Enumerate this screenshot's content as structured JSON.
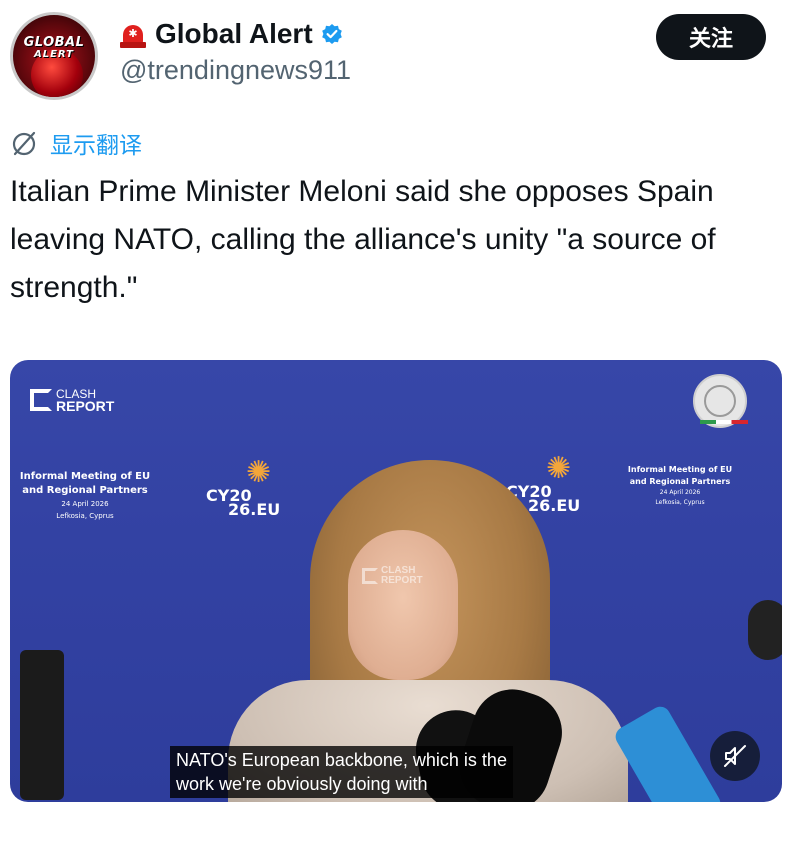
{
  "account": {
    "avatar_text_line1": "GLOBAL",
    "avatar_text_line2": "ALERT",
    "display_name": "Global Alert",
    "handle": "@trendingnews911",
    "verified": true,
    "follow_label": "关注"
  },
  "translate": {
    "label": "显示翻译",
    "icon": "globe-slash-icon"
  },
  "post": {
    "text": "Italian Prime Minister Meloni said she opposes Spain leaving NATO, calling the alliance's unity \"a source of strength.\""
  },
  "media": {
    "watermark_line1": "CLASH",
    "watermark_line2": "REPORT",
    "banner_title_line1": "Informal Meeting of EU",
    "banner_title_line2": "and Regional Partners",
    "banner_date": "24 April 2026",
    "banner_place": "Lefkosia, Cyprus",
    "logo_cy": "CY20",
    "logo_eu": "26.EU",
    "caption_line1": "NATO's European backbone, which is the",
    "caption_line2": "work we're obviously doing with",
    "mute_icon": "speaker-muted-icon"
  },
  "colors": {
    "accent": "#1d9bf0",
    "follow_bg": "#0f1419",
    "video_bg": "#3342a3"
  }
}
